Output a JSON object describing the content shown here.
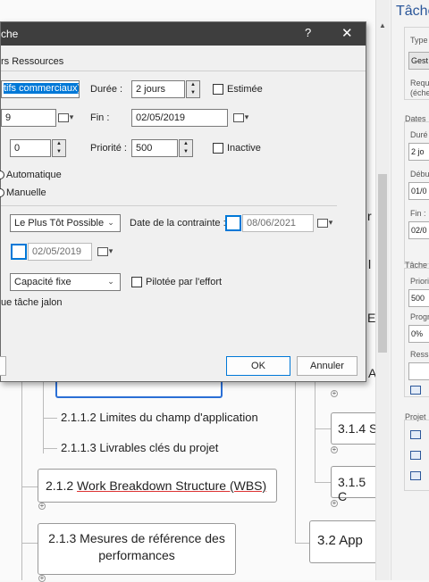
{
  "dialog": {
    "title": "che",
    "help": "?",
    "close": "✕",
    "tabs": "rs  Ressources",
    "name_value": "tifs commerciaux)",
    "duree_label": "Durée :",
    "duree_value": "2 jours",
    "estimee_label": "Estimée",
    "start_value": "9",
    "fin_label": "Fin :",
    "fin_value": "02/05/2019",
    "pct_value": "0",
    "priorite_label": "Priorité :",
    "priorite_value": "500",
    "inactive_label": "Inactive",
    "auto_label": "Automatique",
    "manual_label": "Manuelle",
    "constraint_type": "Le Plus Tôt Possible",
    "constraint_date_label": "Date de la contrainte :",
    "constraint_date_value": "08/06/2021",
    "deadline_value": "02/05/2019",
    "task_type": "Capacité fixe",
    "effort_label": "Pilotée par l'effort",
    "milestone_label": "ue tâche jalon",
    "ok": "OK",
    "cancel": "Annuler"
  },
  "wbs": {
    "n1": "2.1.1.2  Limites du champ d'application",
    "n2": "2.1.1.3  Livrables clés du projet",
    "n3_num": "2.1.2",
    "n3_text": "Work Breakdown Structure (WBS)",
    "n4_line1": "2.1.3  Mesures de référence des",
    "n4_line2": "performances",
    "r1": "3.1.4  S",
    "r2": "3.1.5  C",
    "r3": "3.2  App",
    "edge_a": "A",
    "edge_e": "E",
    "edge_l": "l",
    "edge_r": "r",
    "plus": "+"
  },
  "side_pane": {
    "title": "Tâche",
    "type_label": "Type",
    "type_value": "Gest",
    "req_label1": "Requ",
    "req_label2": "(éche",
    "dates_label": "Dates",
    "duree_label": "Duré",
    "duree_value": "2 jo",
    "debut_label": "Débu",
    "debut_value": "01/0",
    "fin_label": "Fin :",
    "fin_value": "02/0",
    "tache_label": "Tâche",
    "priorite_label": "Priori",
    "priorite_value": "500",
    "progres_label": "Progr",
    "progres_value": "0%",
    "ress_label": "Ress",
    "projet_label": "Projet"
  }
}
